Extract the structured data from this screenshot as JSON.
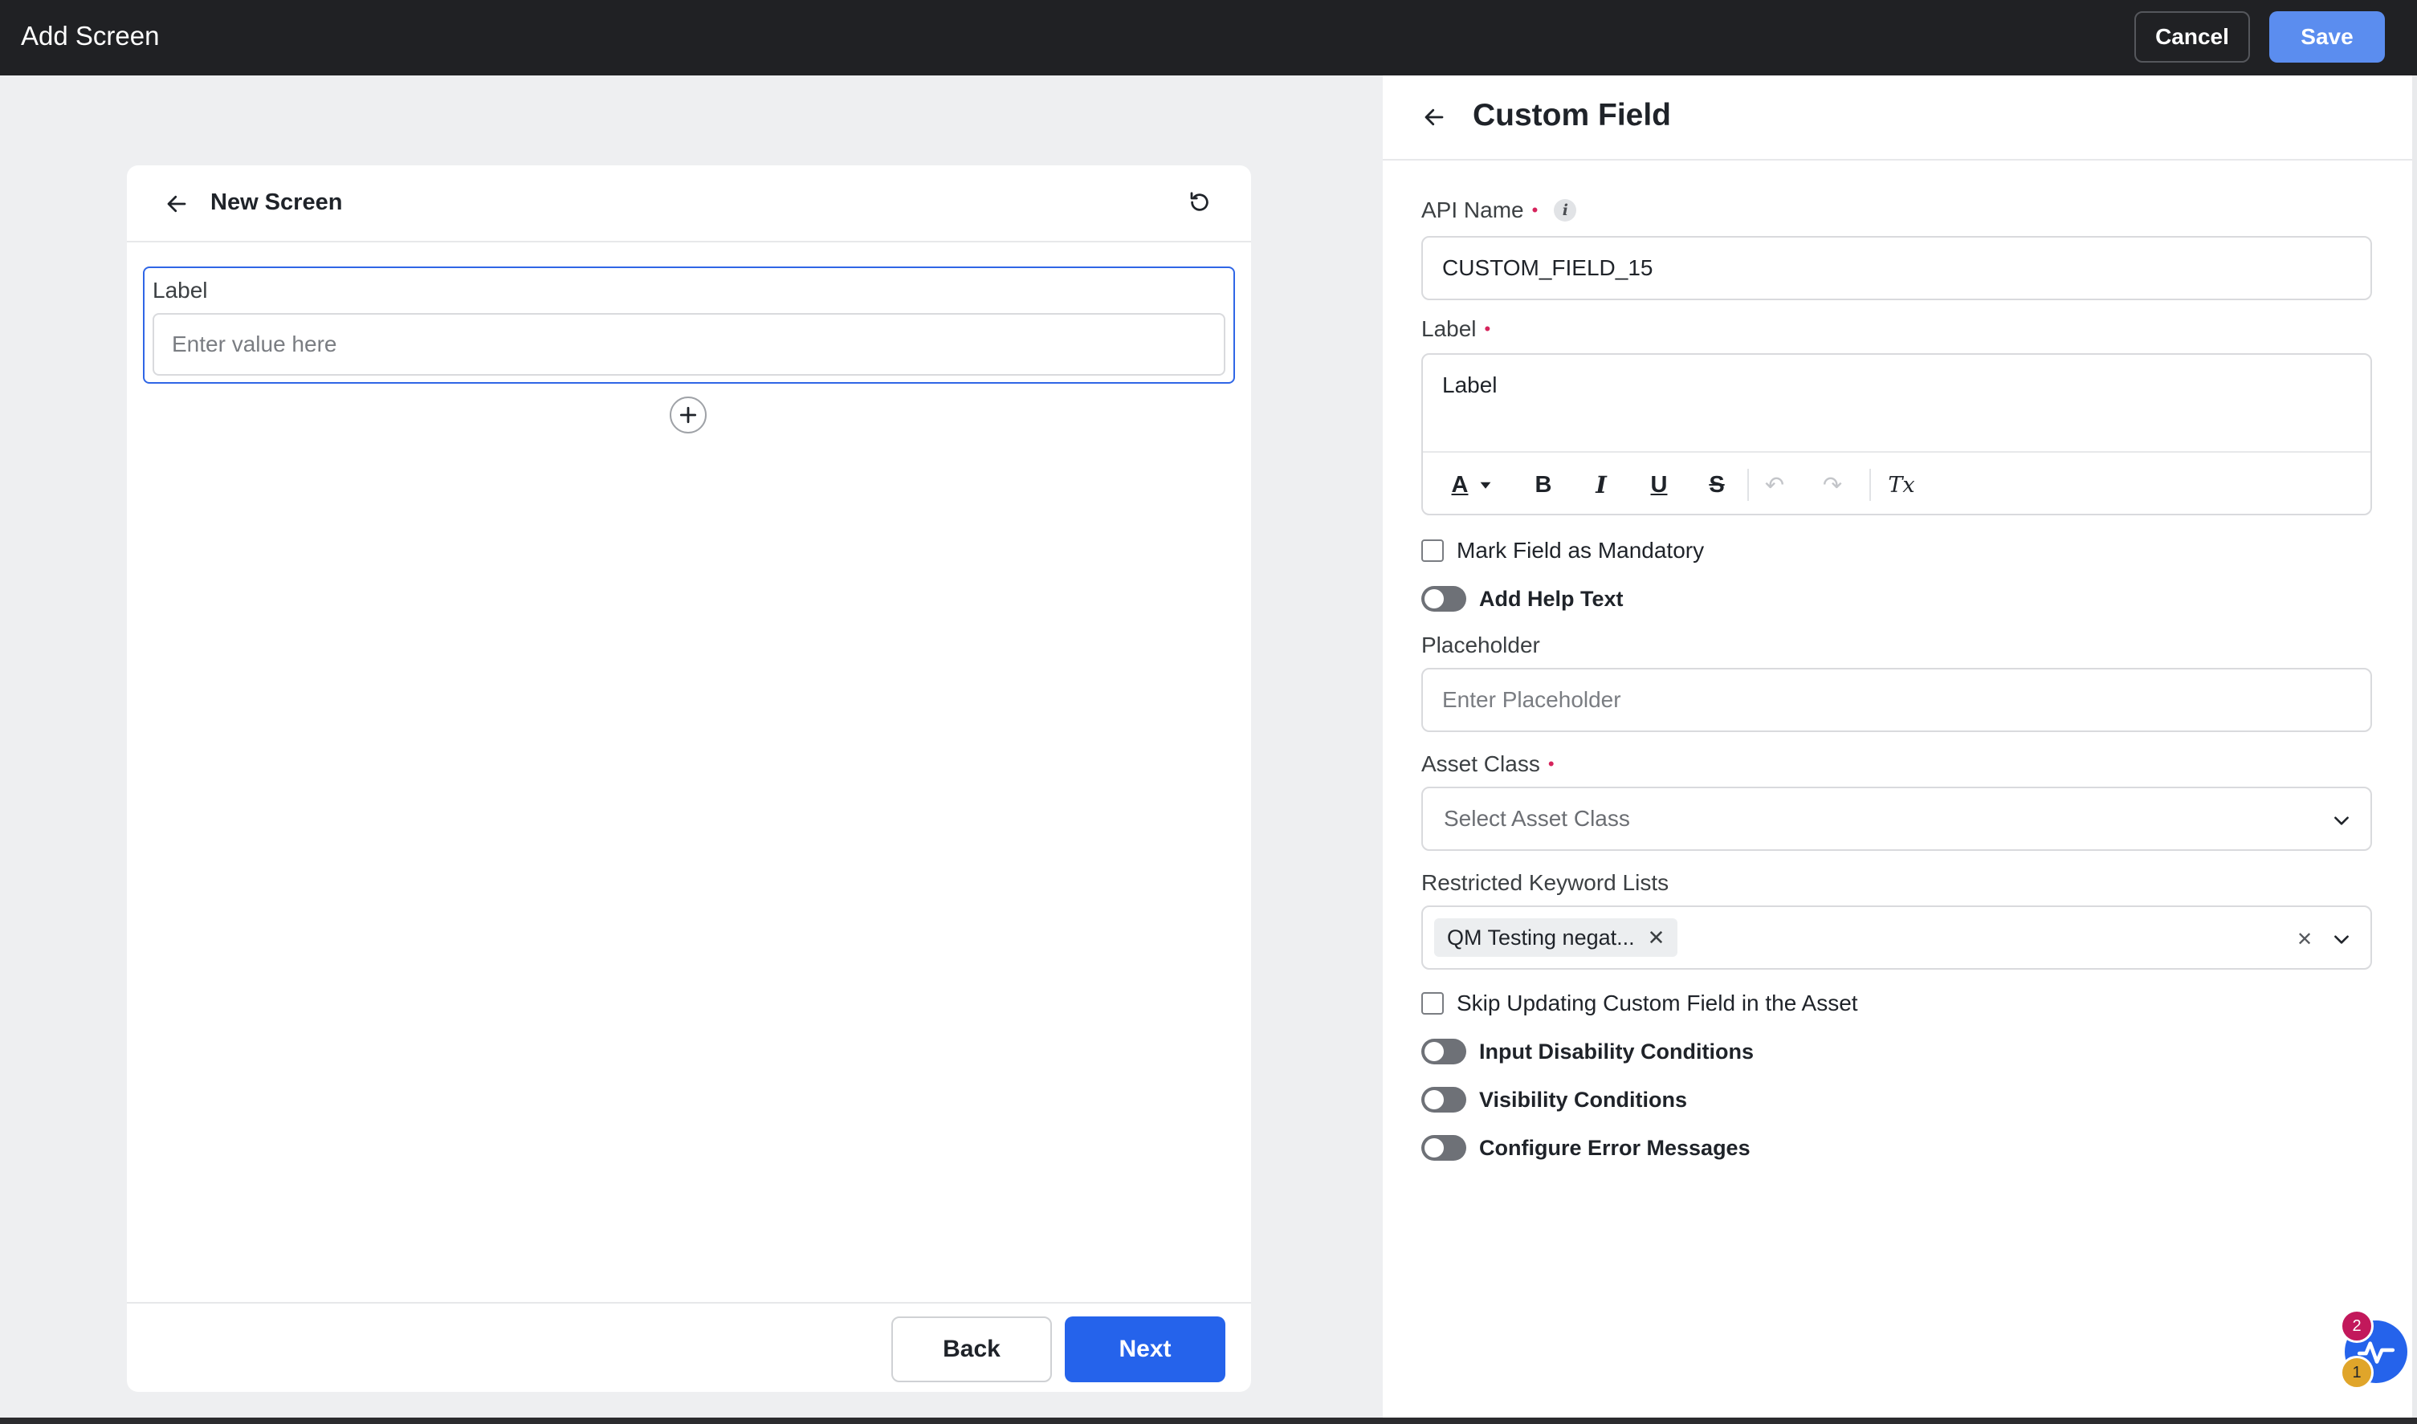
{
  "topbar": {
    "title": "Add Screen",
    "cancel_label": "Cancel",
    "save_label": "Save"
  },
  "canvas": {
    "screen_title": "New Screen",
    "field": {
      "label": "Label",
      "placeholder": "Enter value here"
    },
    "back_label": "Back",
    "next_label": "Next"
  },
  "panel": {
    "title": "Custom Field",
    "api_name": {
      "label": "API Name",
      "required_marker": "•",
      "info_icon": "i",
      "value": "CUSTOM_FIELD_15"
    },
    "label_field": {
      "label": "Label",
      "required_marker": "•",
      "value": "Label"
    },
    "toolbar": {
      "text_color": "A",
      "bold": "B",
      "italic": "I",
      "underline": "U",
      "strike": "S",
      "undo": "↶",
      "redo": "↷",
      "clear_format": "Tx"
    },
    "mark_mandatory": "Mark Field as Mandatory",
    "add_help_text": "Add Help Text",
    "placeholder": {
      "label": "Placeholder",
      "placeholder": "Enter Placeholder"
    },
    "asset_class": {
      "label": "Asset Class",
      "required_marker": "•",
      "placeholder": "Select Asset Class"
    },
    "restricted": {
      "label": "Restricted Keyword Lists",
      "chip": "QM Testing negat..."
    },
    "skip_updating": "Skip Updating Custom Field in the Asset",
    "input_disability": "Input Disability Conditions",
    "visibility": "Visibility Conditions",
    "error_messages": "Configure Error Messages"
  },
  "fab": {
    "icon": "activity-pulse-icon",
    "badge_top": "2",
    "badge_bottom": "1"
  },
  "colors": {
    "accent": "#2563eb",
    "save": "#5b8def",
    "required": "#d6245c",
    "topbar": "#202124"
  }
}
